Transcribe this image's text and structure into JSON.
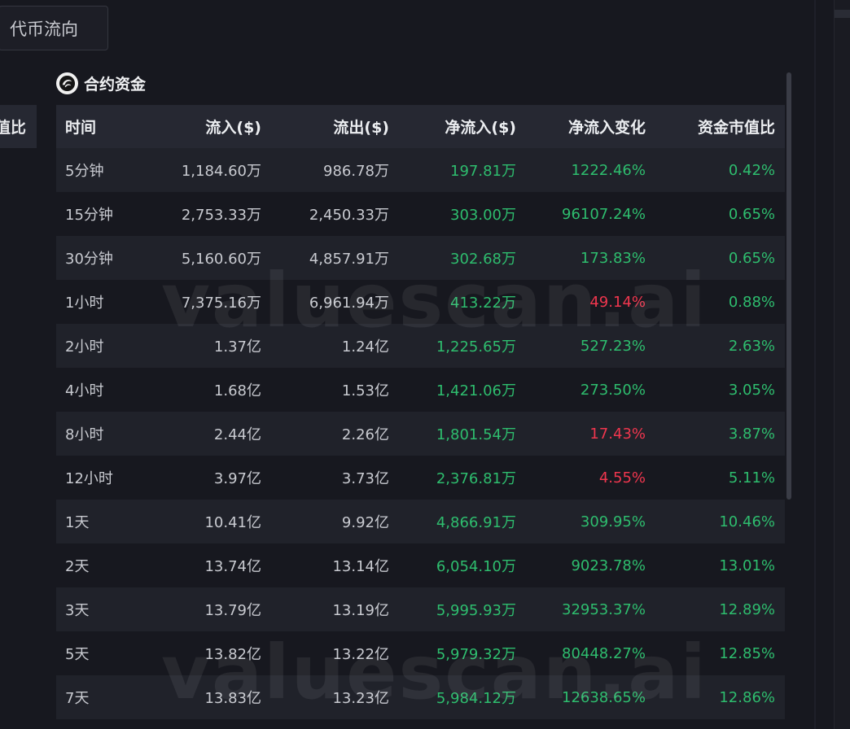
{
  "tab": {
    "label": "代币流向"
  },
  "left_header_fragment": "值比",
  "section": {
    "title": "合约资金",
    "logo_icon": "valuescan-logo-icon"
  },
  "table": {
    "headers": [
      "时间",
      "流入($)",
      "流出($)",
      "净流入($)",
      "净流入变化",
      "资金市值比"
    ],
    "rows": [
      {
        "time": "5分钟",
        "inflow": "1,184.60万",
        "outflow": "986.78万",
        "net": "197.81万",
        "change": "1222.46%",
        "change_color": "green",
        "ratio": "0.42%"
      },
      {
        "time": "15分钟",
        "inflow": "2,753.33万",
        "outflow": "2,450.33万",
        "net": "303.00万",
        "change": "96107.24%",
        "change_color": "green",
        "ratio": "0.65%"
      },
      {
        "time": "30分钟",
        "inflow": "5,160.60万",
        "outflow": "4,857.91万",
        "net": "302.68万",
        "change": "173.83%",
        "change_color": "green",
        "ratio": "0.65%"
      },
      {
        "time": "1小时",
        "inflow": "7,375.16万",
        "outflow": "6,961.94万",
        "net": "413.22万",
        "change": "49.14%",
        "change_color": "red",
        "ratio": "0.88%"
      },
      {
        "time": "2小时",
        "inflow": "1.37亿",
        "outflow": "1.24亿",
        "net": "1,225.65万",
        "change": "527.23%",
        "change_color": "green",
        "ratio": "2.63%"
      },
      {
        "time": "4小时",
        "inflow": "1.68亿",
        "outflow": "1.53亿",
        "net": "1,421.06万",
        "change": "273.50%",
        "change_color": "green",
        "ratio": "3.05%"
      },
      {
        "time": "8小时",
        "inflow": "2.44亿",
        "outflow": "2.26亿",
        "net": "1,801.54万",
        "change": "17.43%",
        "change_color": "red",
        "ratio": "3.87%"
      },
      {
        "time": "12小时",
        "inflow": "3.97亿",
        "outflow": "3.73亿",
        "net": "2,376.81万",
        "change": "4.55%",
        "change_color": "red",
        "ratio": "5.11%"
      },
      {
        "time": "1天",
        "inflow": "10.41亿",
        "outflow": "9.92亿",
        "net": "4,866.91万",
        "change": "309.95%",
        "change_color": "green",
        "ratio": "10.46%"
      },
      {
        "time": "2天",
        "inflow": "13.74亿",
        "outflow": "13.14亿",
        "net": "6,054.10万",
        "change": "9023.78%",
        "change_color": "green",
        "ratio": "13.01%"
      },
      {
        "time": "3天",
        "inflow": "13.79亿",
        "outflow": "13.19亿",
        "net": "5,995.93万",
        "change": "32953.37%",
        "change_color": "green",
        "ratio": "12.89%"
      },
      {
        "time": "5天",
        "inflow": "13.82亿",
        "outflow": "13.22亿",
        "net": "5,979.32万",
        "change": "80448.27%",
        "change_color": "green",
        "ratio": "12.85%"
      },
      {
        "time": "7天",
        "inflow": "13.83亿",
        "outflow": "13.23亿",
        "net": "5,984.12万",
        "change": "12638.65%",
        "change_color": "green",
        "ratio": "12.86%"
      }
    ]
  },
  "watermark": "valuescan.ai",
  "colors": {
    "positive": "#2ebd6e",
    "negative": "#f0364e",
    "background": "#17181f",
    "header_bg": "#262832"
  }
}
